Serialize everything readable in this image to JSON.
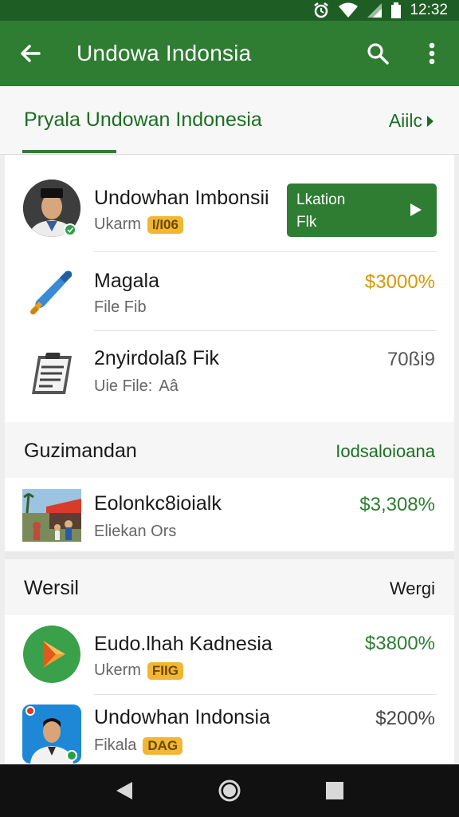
{
  "status_bar": {
    "time": "12:32"
  },
  "app_bar": {
    "title": "Undowa Indonsia"
  },
  "tabs": {
    "main_label": "Pryala Undowan Indonesia",
    "more_label": "Aiilc"
  },
  "list": {
    "items": [
      {
        "primary": "Undowhan Imbonsii",
        "secondary": "Ukarm",
        "badge": "I/I06",
        "action_line1": "Lkation",
        "action_line2": "Flk"
      },
      {
        "primary": "Magala",
        "secondary": "File Fib",
        "value": "$3000%",
        "value_color": "#d49a00"
      },
      {
        "primary": "2nyirdolaß Fik",
        "secondary": "Uie File:",
        "secondary_extra": "Aâ",
        "value": "70ßi9",
        "value_color": "#555555"
      }
    ],
    "section1": {
      "title": "Guzimandan",
      "link": "Iodsaloioana"
    },
    "section1_items": [
      {
        "primary": "Eolonkc8ioialk",
        "secondary": "Eliekan Ors",
        "value": "$3,308%",
        "value_color": "#2e7d32"
      }
    ],
    "section2": {
      "title": "Wersil",
      "link": "Wergi"
    },
    "section2_items": [
      {
        "primary": "Eudo.lhah Kadnesia",
        "secondary": "Ukerm",
        "badge": "FIIG",
        "value": "$3800%",
        "value_color": "#2e7d32"
      },
      {
        "primary": "Undowhan Indonsia",
        "secondary": "Fikala",
        "badge": "DAG",
        "value": "$200%",
        "value_color": "#444444"
      }
    ]
  },
  "colors": {
    "primary": "#2e7d32",
    "status_bar": "#1e5e24",
    "accent_gold": "#f2b632"
  },
  "icons": [
    "back-arrow-icon",
    "search-icon",
    "more-vert-icon",
    "avatar",
    "brush-icon",
    "clipboard-icon",
    "photo-thumbnail",
    "play-logo-icon",
    "avatar-2",
    "triangle-back-icon",
    "circle-home-icon",
    "square-recents-icon"
  ]
}
